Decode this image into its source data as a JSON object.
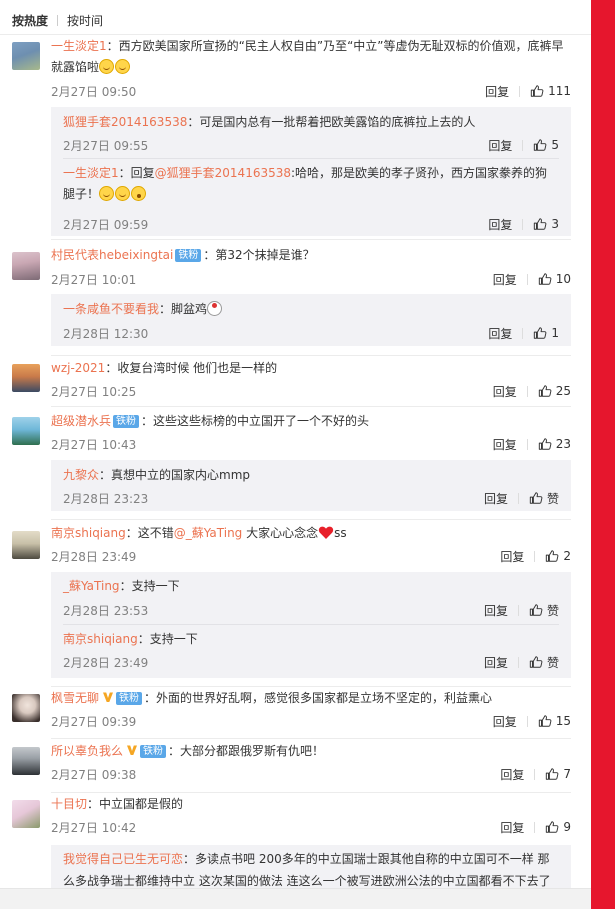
{
  "tabs": [
    "按热度",
    "按时间"
  ],
  "reply_label": "回复",
  "like_label": "赞",
  "comments": [
    {
      "user": "一生淡定1",
      "text": "：西方欧美国家所宣扬的“民主人权自由”乃至“中立”等虚伪无耻双标的价值观，底裤早就露馅啦",
      "date": "2月27日 09:50",
      "likes": "111",
      "avatar_color": [
        "#6e8fb0",
        "#a8b98b"
      ],
      "replies": [
        {
          "user": "狐狸手套2014163538",
          "text": "：可是国内总有一批帮着把欧美露馅的底裤拉上去的人",
          "date": "2月27日 09:55",
          "likes": "5"
        },
        {
          "user": "一生淡定1",
          "text_prefix": "：回复",
          "mention": "@狐狸手套2014163538",
          "text": ":哈哈，那是欧美的孝子贤孙，西方国家豢养的狗腿子！",
          "date": "2月27日 09:59",
          "likes": "3"
        }
      ]
    },
    {
      "user": "村民代表hebeixingtai",
      "badge": "铁粉",
      "text": "：第32个抹掉是谁？",
      "date": "2月27日 10:01",
      "likes": "10",
      "avatar_color": [
        "#c9a7b3",
        "#7d6a75"
      ],
      "replies": [
        {
          "user": "一条咸鱼不要看我",
          "text": "：脚盆鸡",
          "date": "2月28日 12:30",
          "likes": "1"
        }
      ]
    },
    {
      "user": "wzj-2021",
      "text": "：收复台湾时候 他们也是一样的",
      "date": "2月27日 10:25",
      "likes": "25",
      "avatar_color": [
        "#e8a15b",
        "#3b4a63"
      ]
    },
    {
      "user": "超级潜水兵",
      "badge": "铁粉",
      "text": "：这些这些标榜的中立国开了一个不好的头",
      "date": "2月27日 10:43",
      "likes": "23",
      "avatar_color": [
        "#6fb7d8",
        "#2f6f4f"
      ],
      "replies": [
        {
          "user": "九黎众",
          "text": "：真想中立的国家内心mmp",
          "date": "2月28日 23:23",
          "likes": "赞"
        }
      ]
    },
    {
      "user": "南京shiqiang",
      "text": "：这不错",
      "mention": "@_蘇YaTing",
      "text_after": " 大家心心念念",
      "text_end": "ss",
      "date": "2月28日 23:49",
      "likes": "2",
      "avatar_color": [
        "#c8c0a8",
        "#4d4a40"
      ],
      "replies": [
        {
          "user": "_蘇YaTing",
          "text": "：支持一下",
          "date": "2月28日 23:53",
          "likes": "赞"
        },
        {
          "user": "南京shiqiang",
          "text": "：支持一下",
          "date": "2月28日 23:49",
          "likes": "赞"
        }
      ]
    },
    {
      "user": "枫雪无聊",
      "badge": "铁粉",
      "verified": true,
      "text": "：外面的世界好乱啊，感觉很多国家都是立场不坚定的，利益熏心",
      "date": "2月27日 09:39",
      "likes": "15",
      "avatar_color": [
        "#d9c9c0",
        "#3a2f2c"
      ]
    },
    {
      "user": "所以辜负我么",
      "badge": "铁粉",
      "verified": true,
      "text": "：大部分都跟俄罗斯有仇吧！",
      "date": "2月27日 09:38",
      "likes": "7",
      "avatar_color": [
        "#9aa0a6",
        "#2d3135"
      ]
    },
    {
      "user": "十目切",
      "text": "：中立国都是假的",
      "date": "2月27日 10:42",
      "likes": "9",
      "avatar_color": [
        "#e6c7d8",
        "#8a9a6b"
      ],
      "replies": [
        {
          "user": "我觉得自己已生无可恋",
          "text": "：多读点书吧 200多年的中立国瑞士跟其他自称的中立国可不一样 那么多战争瑞士都维持中立 这次某国的做法 连这么一个被写进欧洲公法的中立国都看不下去了 正"
        }
      ]
    }
  ]
}
